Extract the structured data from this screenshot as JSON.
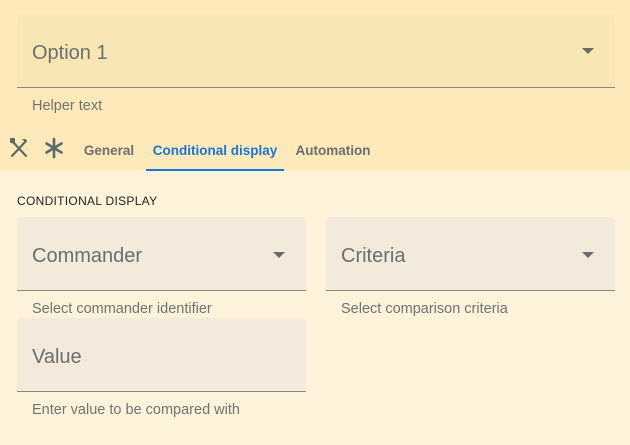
{
  "option_field": {
    "value": "Option 1",
    "helper": "Helper text",
    "icon": "chevron-down-icon"
  },
  "tabs": {
    "icons": [
      "tools-icon",
      "asterisk-icon"
    ],
    "items": [
      {
        "label": "General",
        "active": false
      },
      {
        "label": "Conditional display",
        "active": true
      },
      {
        "label": "Automation",
        "active": false
      }
    ],
    "accent_color": "#1976d2"
  },
  "conditional_display": {
    "section_title": "CONDITIONAL DISPLAY",
    "commander": {
      "placeholder": "Commander",
      "helper": "Select commander identifier"
    },
    "criteria": {
      "placeholder": "Criteria",
      "helper": "Select comparison criteria"
    },
    "value": {
      "placeholder": "Value",
      "helper": "Enter value to be compared with"
    }
  },
  "colors": {
    "top_background": "#fde9b9",
    "panel_background": "#fef3da"
  }
}
